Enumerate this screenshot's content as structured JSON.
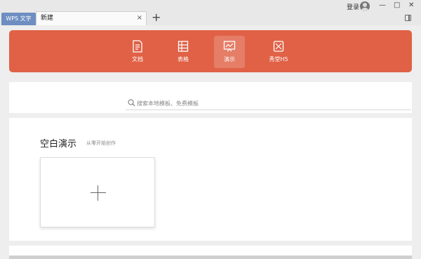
{
  "titlebar": {
    "app_tab": "WPS 文字",
    "doc_tab": "新建",
    "close_glyph": "×",
    "add_glyph": "+",
    "login": "登录",
    "min_glyph": "—",
    "max_glyph": "□",
    "close_window_glyph": "✕"
  },
  "banner": {
    "color": "#e06146",
    "items": [
      {
        "label": "文档",
        "icon": "document-icon"
      },
      {
        "label": "表格",
        "icon": "table-icon"
      },
      {
        "label": "演示",
        "icon": "presentation-icon",
        "active": true
      },
      {
        "label": "秀堂H5",
        "icon": "h5-icon"
      }
    ]
  },
  "search": {
    "placeholder": "搜索本地模板、免费模板"
  },
  "content": {
    "title": "空白演示",
    "subtitle": "从零开始创作"
  }
}
